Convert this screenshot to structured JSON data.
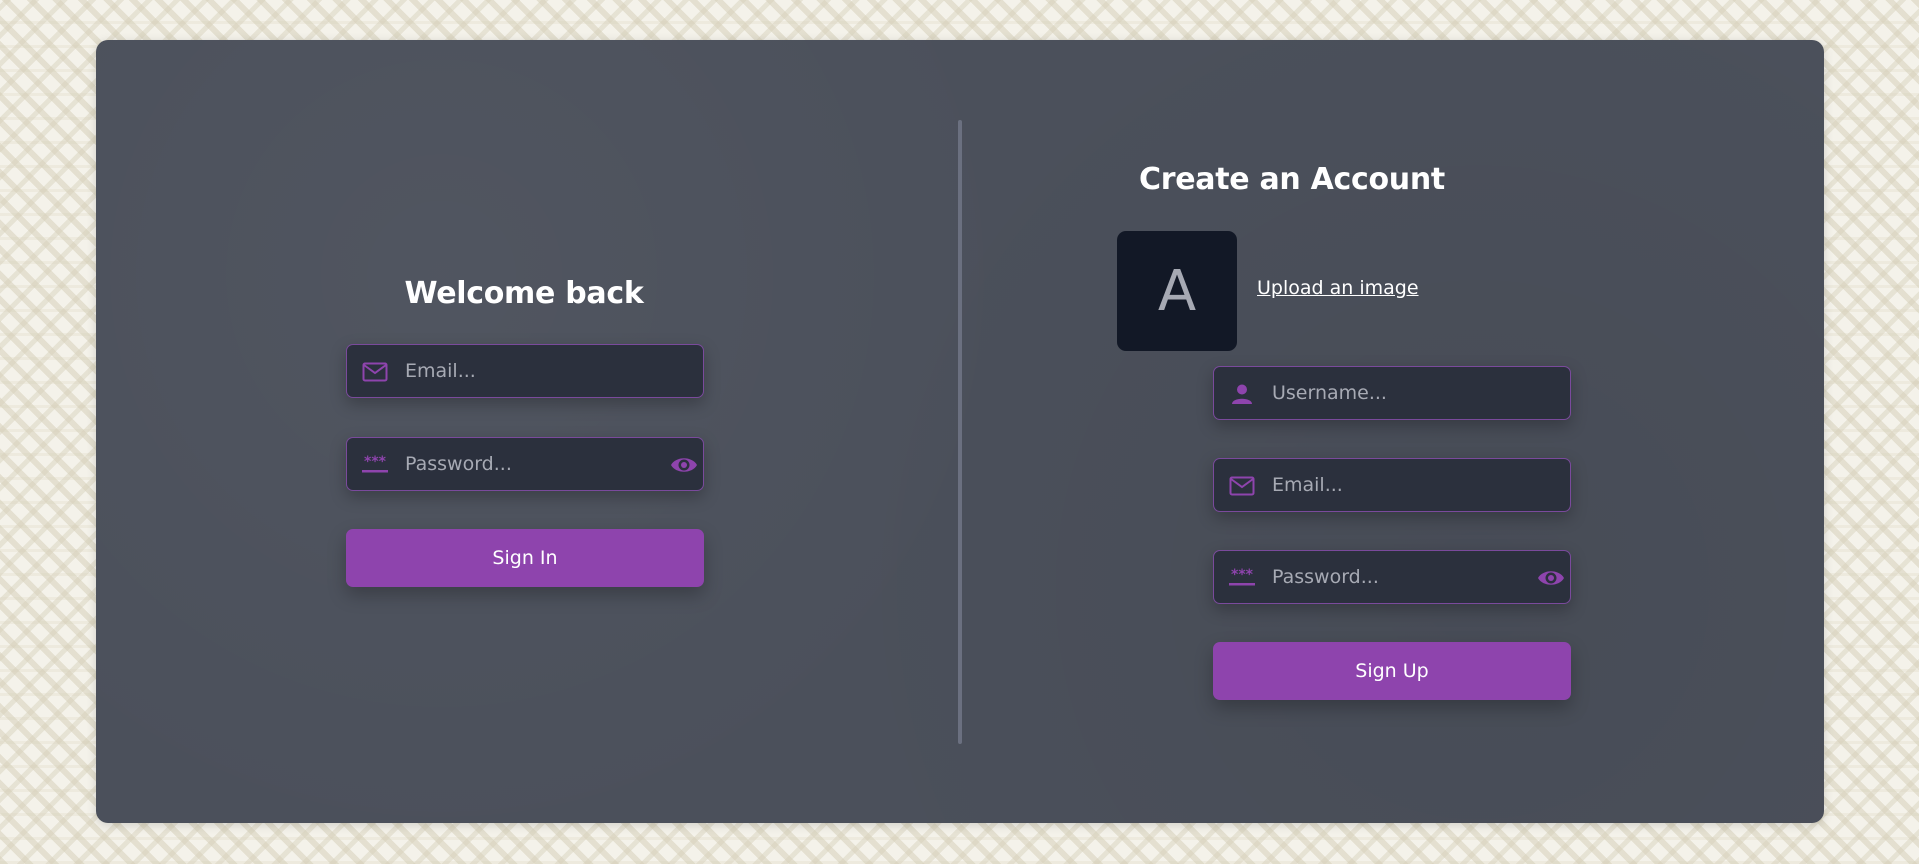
{
  "login": {
    "heading": "Welcome back",
    "email_placeholder": "Email...",
    "password_placeholder": "Password...",
    "submit_label": "Sign In"
  },
  "signup": {
    "heading": "Create an Account",
    "avatar_letter": "A",
    "upload_label": "Upload an image",
    "username_placeholder": "Username...",
    "email_placeholder": "Email...",
    "password_placeholder": "Password...",
    "submit_label": "Sign Up"
  },
  "icons": {
    "email": "mail-icon",
    "password": "password-icon",
    "username": "user-icon",
    "toggle": "eye-icon"
  },
  "colors": {
    "accent": "#8e44ad",
    "card_bg": "#4b505b",
    "field_bg": "#2b303d",
    "field_border": "#7a4a9c",
    "avatar_bg": "#121826"
  }
}
